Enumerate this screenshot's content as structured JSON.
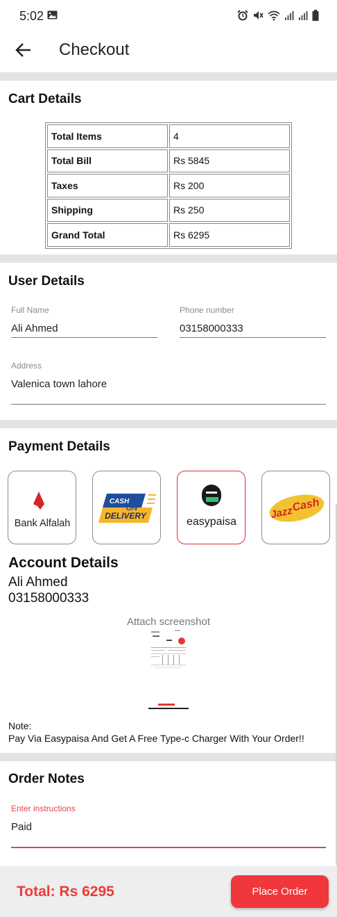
{
  "status_bar": {
    "time": "5:02"
  },
  "app_bar": {
    "title": "Checkout",
    "back_icon": "arrow-left-icon"
  },
  "cart_details": {
    "title": "Cart Details",
    "rows": [
      {
        "label": "Total Items",
        "value": "4"
      },
      {
        "label": "Total Bill",
        "value": "Rs 5845"
      },
      {
        "label": "Taxes",
        "value": "Rs 200"
      },
      {
        "label": "Shipping",
        "value": "Rs 250"
      },
      {
        "label": "Grand Total",
        "value": "Rs 6295"
      }
    ]
  },
  "user_details": {
    "title": "User Details",
    "full_name": {
      "label": "Full Name",
      "value": "Ali Ahmed"
    },
    "phone": {
      "label": "Phone number",
      "value": "03158000333"
    },
    "address": {
      "label": "Address",
      "value": "Valenica town lahore"
    }
  },
  "payment_details": {
    "title": "Payment Details",
    "methods": [
      {
        "name": "Bank Alfalah",
        "selected": false
      },
      {
        "name": "Cash on Delivery",
        "logo_text_1": "CASH",
        "logo_text_2": "ON",
        "logo_text_3": "DELIVERY",
        "selected": false
      },
      {
        "name": "easypaisa",
        "selected": true
      },
      {
        "name": "JazzCash",
        "logo_text_1": "Jazz",
        "logo_text_2": "Cash",
        "selected": false
      }
    ],
    "accent_selected": "#d9303a"
  },
  "account_details": {
    "title": "Account Details",
    "name": "Ali Ahmed",
    "number": "03158000333",
    "attach_label": "Attach screenshot"
  },
  "note": {
    "label": "Note:",
    "text": "Pay Via Easypaisa And Get A Free Type-c Charger With Your Order!!"
  },
  "order_notes": {
    "title": "Order Notes",
    "label": "Enter instructions",
    "value": "Paid",
    "accent": "#e0454b"
  },
  "footer": {
    "total": "Total: Rs 6295",
    "place_order": "Place Order",
    "accent": "#f0373c"
  }
}
